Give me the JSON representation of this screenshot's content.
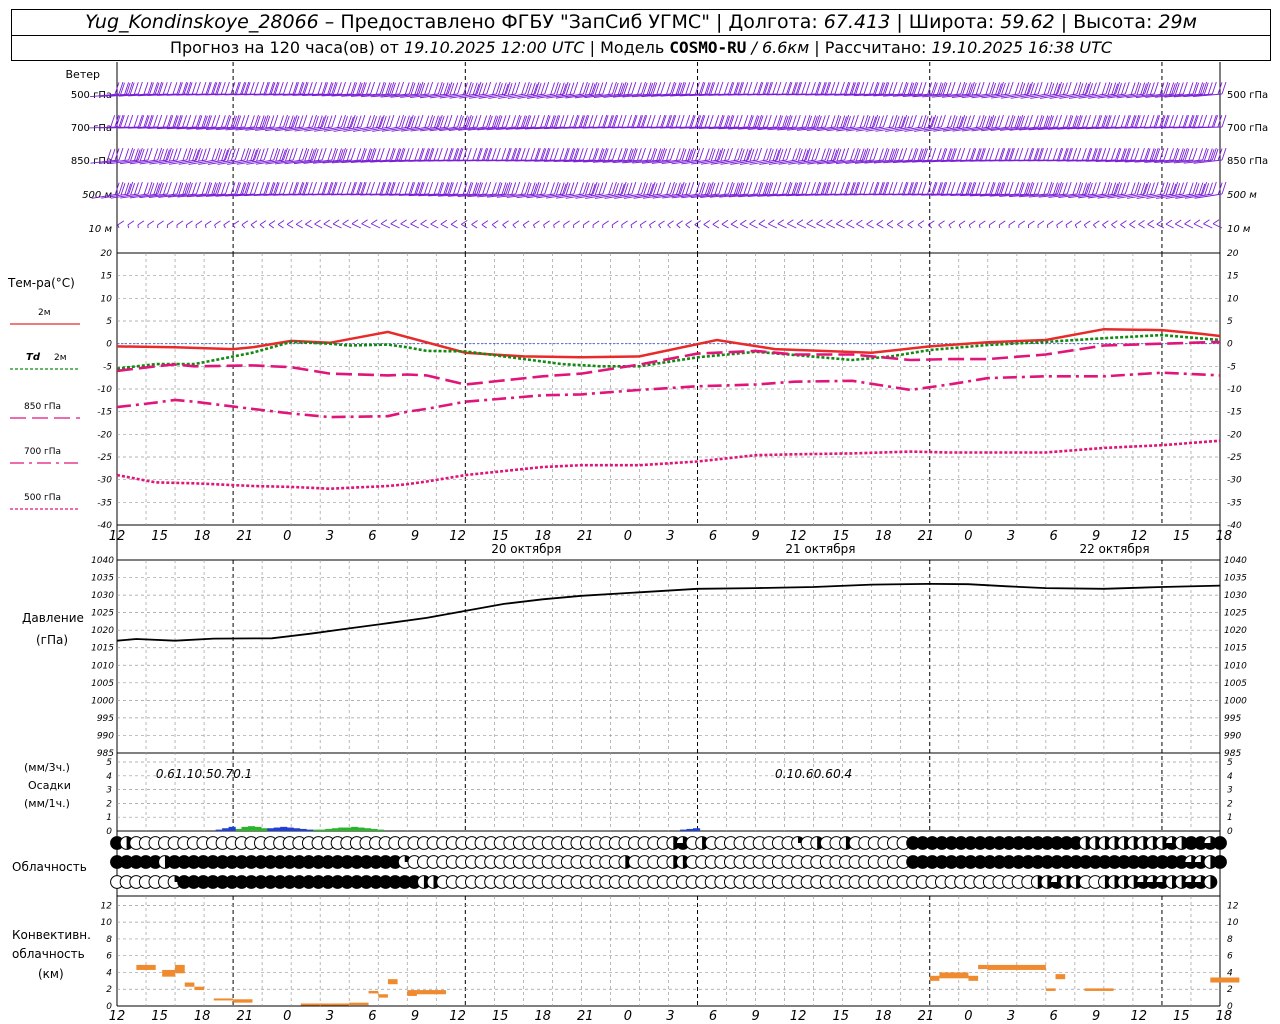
{
  "header": {
    "station": "Yug_Kondinskoye_28066",
    "provider_text": " – Предоставлено ФГБУ \"ЗапСиб УГМС\" | Долгота: ",
    "lon": "67.413",
    "lat_label": " | Широта: ",
    "lat": "59.62",
    "alt_label": " | Высота: ",
    "alt": "29м",
    "forecast_label": "Прогноз на 120 часа(ов) от ",
    "start_time": "19.10.2025 12:00 UTC",
    "model_label": " | Модель ",
    "model": "COSMO-RU",
    "resolution": " / 6.6км",
    "computed_label": " | Рассчитано: ",
    "computed": "19.10.2025 16:38 UTC"
  },
  "chart_data": [
    {
      "type": "wind-barbs",
      "label": "Ветер",
      "levels": [
        "500 гПа",
        "700 гПа",
        "850 гПа",
        "500 м",
        "10 м"
      ],
      "color": "#7a1fd6"
    },
    {
      "type": "line",
      "ylabel": "Тем-ра(°C)",
      "ylim": [
        -40,
        20
      ],
      "yticks": [
        20,
        15,
        10,
        5,
        0,
        -5,
        -10,
        -15,
        -20,
        -25,
        -30,
        -35,
        -40
      ],
      "series": [
        {
          "name": "2м",
          "color": "#e82a2a",
          "style": "solid",
          "x": [
            0,
            9,
            18,
            21,
            27,
            33,
            42,
            54,
            63,
            72,
            81,
            93,
            102,
            117,
            126,
            135,
            144,
            153,
            162,
            168,
            171
          ],
          "values": [
            -0.6,
            -0.8,
            -1.2,
            -0.8,
            0.6,
            0.2,
            2.6,
            -2.0,
            -2.8,
            -3.0,
            -2.8,
            0.8,
            -1.2,
            -2.0,
            -0.6,
            0.3,
            0.8,
            3.2,
            3.0,
            2.2,
            1.7
          ]
        },
        {
          "name": "Td 2м",
          "color": "#128a12",
          "style": "dotted",
          "x": [
            0,
            6,
            12,
            21,
            27,
            33,
            36,
            42,
            45,
            48,
            54,
            60,
            69,
            75,
            81,
            90,
            99,
            105,
            114,
            120,
            126,
            135,
            144,
            153,
            162,
            171
          ],
          "values": [
            -5.5,
            -4.5,
            -4.5,
            -2.0,
            0.4,
            0.0,
            -0.4,
            -0.2,
            -0.8,
            -1.6,
            -1.7,
            -2.8,
            -4.5,
            -5.0,
            -5.0,
            -3.0,
            -1.8,
            -2.5,
            -3.6,
            -2.8,
            -1.4,
            -0.3,
            0.4,
            1.2,
            1.9,
            0.8
          ]
        },
        {
          "name": "850 гПа",
          "color": "#e0147a",
          "style": "long-dash",
          "x": [
            0,
            6,
            9,
            12,
            21,
            27,
            33,
            42,
            45,
            48,
            54,
            66,
            72,
            81,
            90,
            99,
            105,
            114,
            123,
            129,
            135,
            144,
            153,
            162,
            171
          ],
          "values": [
            -6.0,
            -5.0,
            -4.6,
            -5.0,
            -4.8,
            -5.2,
            -6.6,
            -7.0,
            -6.8,
            -7.0,
            -9.0,
            -7.2,
            -6.6,
            -4.6,
            -2.2,
            -1.6,
            -2.4,
            -2.4,
            -3.6,
            -3.4,
            -3.4,
            -2.4,
            -0.4,
            0.0,
            0.4
          ]
        },
        {
          "name": "700 гПа",
          "color": "#e0147a",
          "style": "dash-dot",
          "x": [
            0,
            6,
            9,
            12,
            21,
            27,
            33,
            42,
            45,
            48,
            54,
            66,
            72,
            81,
            90,
            99,
            105,
            114,
            123,
            129,
            135,
            144,
            153,
            162,
            171
          ],
          "values": [
            -14.0,
            -13.0,
            -12.4,
            -12.8,
            -14.4,
            -15.4,
            -16.2,
            -16.0,
            -15.0,
            -14.4,
            -12.8,
            -11.4,
            -11.2,
            -10.2,
            -9.4,
            -9.0,
            -8.4,
            -8.2,
            -10.2,
            -9.0,
            -7.6,
            -7.2,
            -7.2,
            -6.4,
            -7.0
          ]
        },
        {
          "name": "500 гПа",
          "color": "#e0147a",
          "style": "dotted",
          "x": [
            0,
            6,
            12,
            21,
            27,
            33,
            42,
            45,
            48,
            54,
            66,
            72,
            81,
            90,
            99,
            105,
            114,
            123,
            129,
            135,
            144,
            153,
            162,
            171
          ],
          "values": [
            -29.0,
            -30.6,
            -30.8,
            -31.4,
            -31.6,
            -32.0,
            -31.4,
            -31.0,
            -30.4,
            -29.0,
            -27.2,
            -26.8,
            -26.8,
            -26.0,
            -24.6,
            -24.4,
            -24.2,
            -23.8,
            -24.0,
            -24.0,
            -24.0,
            -23.0,
            -22.4,
            -21.4
          ]
        }
      ]
    },
    {
      "type": "line",
      "ylabel": "Давление",
      "yunit": "(гПа)",
      "ylim": [
        985,
        1040
      ],
      "yticks": [
        1040,
        1035,
        1030,
        1025,
        1020,
        1015,
        1010,
        1005,
        1000,
        995,
        990,
        985
      ],
      "series": [
        {
          "name": "Давление",
          "color": "#000000",
          "x": [
            0,
            3,
            9,
            15,
            24,
            30,
            36,
            42,
            48,
            54,
            60,
            66,
            72,
            81,
            90,
            99,
            108,
            117,
            126,
            132,
            138,
            144,
            153,
            162,
            171
          ],
          "values": [
            1017,
            1017.5,
            1017,
            1017.6,
            1017.7,
            1019,
            1020.5,
            1022,
            1023.5,
            1025.5,
            1027.5,
            1028.8,
            1029.8,
            1030.8,
            1031.8,
            1032,
            1032.3,
            1033,
            1033.2,
            1033.1,
            1032.5,
            1032,
            1031.8,
            1032.3,
            1032.7
          ]
        }
      ]
    },
    {
      "type": "bar",
      "ylabel": "(мм/3ч.)",
      "ylabel2": "Осадки",
      "ylabel3": "(мм/1ч.)",
      "ylim": [
        0,
        5
      ],
      "yticks": [
        5,
        4,
        3,
        2,
        1,
        0
      ],
      "totals": [
        {
          "x": 7.5,
          "value": "0.6"
        },
        {
          "x": 10.5,
          "value": "1.1"
        },
        {
          "x": 13.5,
          "value": "0.5"
        },
        {
          "x": 16.5,
          "value": "0.7"
        },
        {
          "x": 19.5,
          "value": "0.1"
        },
        {
          "x": 103.5,
          "value": "0.1"
        },
        {
          "x": 106.5,
          "value": "0.6"
        },
        {
          "x": 109.5,
          "value": "0.6"
        },
        {
          "x": 112.5,
          "value": "0.4"
        }
      ],
      "series": [
        {
          "name": "rain",
          "color": "#2ab42a",
          "bars": [
            [
              9,
              0.15
            ],
            [
              10,
              0.3
            ],
            [
              11,
              0.35
            ],
            [
              12,
              0.3
            ],
            [
              13,
              0.2
            ],
            [
              21,
              0.1
            ],
            [
              22,
              0.1
            ],
            [
              23,
              0.15
            ],
            [
              24,
              0.2
            ],
            [
              25,
              0.25
            ],
            [
              26,
              0.25
            ],
            [
              27,
              0.3
            ],
            [
              28,
              0.25
            ],
            [
              29,
              0.2
            ],
            [
              30,
              0.15
            ],
            [
              31,
              0.1
            ]
          ]
        },
        {
          "name": "snow",
          "color": "#1f3fd6",
          "bars": [
            [
              6,
              0.1
            ],
            [
              7,
              0.2
            ],
            [
              8,
              0.3
            ],
            [
              14,
              0.2
            ],
            [
              15,
              0.25
            ],
            [
              16,
              0.3
            ],
            [
              17,
              0.25
            ],
            [
              18,
              0.2
            ],
            [
              19,
              0.15
            ],
            [
              20,
              0.1
            ],
            [
              78,
              0.1
            ],
            [
              79,
              0.15
            ],
            [
              80,
              0.2
            ]
          ]
        }
      ]
    },
    {
      "type": "cloud-cover",
      "ylabel": "Облачность",
      "rows": [
        [
          8,
          4,
          0,
          0,
          0,
          0,
          0,
          0,
          0,
          0,
          0,
          0,
          0,
          0,
          0,
          0,
          0,
          0,
          0,
          0,
          0,
          0,
          0,
          0,
          0,
          0,
          0,
          0,
          0,
          0,
          0,
          0,
          0,
          0,
          0,
          0,
          0,
          0,
          0,
          0,
          0,
          0,
          0,
          0,
          0,
          0,
          0,
          0,
          0,
          0,
          0,
          0,
          0,
          0,
          0,
          0,
          0,
          0,
          4,
          6,
          0,
          4,
          0,
          0,
          0,
          0,
          0,
          0,
          0,
          0,
          0,
          2,
          0,
          4,
          0,
          0,
          4,
          0,
          0,
          0,
          0,
          0,
          0,
          8,
          8,
          8,
          8,
          8,
          8,
          8,
          8,
          8,
          8,
          8,
          8,
          8,
          8,
          8,
          8,
          8,
          8,
          4,
          4,
          4,
          4,
          4,
          4,
          4,
          4,
          4,
          6,
          4,
          8,
          8,
          6,
          8
        ],
        [
          8,
          8,
          8,
          8,
          8,
          4,
          8,
          8,
          8,
          8,
          8,
          8,
          8,
          8,
          8,
          8,
          8,
          8,
          8,
          8,
          8,
          8,
          8,
          8,
          8,
          8,
          8,
          8,
          8,
          8,
          2,
          0,
          0,
          0,
          0,
          0,
          0,
          0,
          0,
          0,
          0,
          0,
          0,
          0,
          0,
          0,
          0,
          0,
          0,
          0,
          0,
          0,
          0,
          4,
          0,
          0,
          0,
          0,
          4,
          4,
          0,
          0,
          0,
          0,
          0,
          0,
          0,
          0,
          0,
          0,
          0,
          0,
          0,
          0,
          0,
          0,
          0,
          0,
          0,
          0,
          0,
          0,
          0,
          8,
          8,
          8,
          8,
          8,
          8,
          8,
          8,
          8,
          8,
          8,
          8,
          8,
          8,
          8,
          8,
          8,
          8,
          8,
          8,
          8,
          8,
          8,
          8,
          8,
          8,
          8,
          8,
          8,
          6,
          6,
          4,
          8
        ],
        [
          0,
          0,
          0,
          0,
          0,
          0,
          2,
          8,
          8,
          8,
          8,
          8,
          8,
          8,
          8,
          8,
          8,
          8,
          8,
          8,
          8,
          8,
          8,
          8,
          8,
          8,
          8,
          8,
          8,
          8,
          8,
          8,
          4,
          4,
          0,
          0,
          0,
          0,
          0,
          0,
          0,
          0,
          0,
          0,
          0,
          0,
          0,
          0,
          0,
          0,
          0,
          0,
          0,
          0,
          0,
          0,
          0,
          0,
          0,
          0,
          0,
          0,
          0,
          0,
          0,
          0,
          0,
          0,
          0,
          0,
          0,
          0,
          0,
          0,
          0,
          0,
          0,
          0,
          0,
          0,
          0,
          0,
          0,
          0,
          0,
          0,
          0,
          0,
          0,
          0,
          0,
          0,
          0,
          0,
          0,
          0,
          4,
          4,
          6,
          4,
          4,
          0,
          0,
          4,
          4,
          4,
          4,
          6,
          6,
          6,
          4,
          4,
          6,
          6,
          4
        ]
      ]
    },
    {
      "type": "bar",
      "ylabel": "Конвективн.",
      "ylabel2": "облачность",
      "ylabel3": "(км)",
      "ylim": [
        0,
        13
      ],
      "yticks": [
        12,
        10,
        8,
        6,
        4,
        2,
        0
      ],
      "color": "#ef8a2e",
      "segments": [
        [
          6,
          12,
          4.3,
          4.9
        ],
        [
          14,
          18,
          3.5,
          4.3
        ],
        [
          18,
          21,
          3.9,
          4.9
        ],
        [
          21,
          24,
          2.3,
          2.8
        ],
        [
          24,
          27,
          1.9,
          2.3
        ],
        [
          30,
          36,
          0.7,
          0.9
        ],
        [
          36,
          42,
          0.4,
          0.8
        ],
        [
          57,
          66,
          0.1,
          0.3
        ],
        [
          66,
          72,
          0.1,
          0.3
        ],
        [
          72,
          78,
          0.1,
          0.4
        ],
        [
          78,
          81,
          1.5,
          1.8
        ],
        [
          81,
          84,
          1.0,
          1.4
        ],
        [
          84,
          87,
          2.6,
          3.2
        ],
        [
          90,
          93,
          1.2,
          1.9
        ],
        [
          93,
          102,
          1.4,
          1.9
        ],
        [
          252,
          255,
          3.0,
          3.6
        ],
        [
          255,
          264,
          3.3,
          4.0
        ],
        [
          264,
          267,
          3.0,
          3.6
        ],
        [
          267,
          270,
          4.4,
          4.9
        ],
        [
          270,
          288,
          4.3,
          4.9
        ],
        [
          288,
          291,
          1.8,
          2.1
        ],
        [
          291,
          294,
          3.2,
          3.8
        ],
        [
          300,
          309,
          1.8,
          2.1
        ],
        [
          339,
          348,
          2.8,
          3.4
        ]
      ]
    }
  ],
  "axis": {
    "hour_labels": [
      "12",
      "15",
      "18",
      "21",
      "0",
      "3",
      "6",
      "9",
      "12",
      "15",
      "18",
      "21",
      "0",
      "3",
      "6",
      "9",
      "12",
      "15",
      "18",
      "21",
      "0",
      "3",
      "6",
      "9",
      "12",
      "15",
      "18"
    ],
    "dates": [
      {
        "x": 33,
        "text": "20 октября"
      },
      {
        "x": 57,
        "text": "21 октября"
      },
      {
        "x": 81,
        "text": "22 октября"
      }
    ]
  },
  "legend": {
    "t2m": "2м",
    "td": "Td",
    "td_sub": "2м",
    "p850": "850 гПа",
    "p700": "700 гПа",
    "p500": "500 гПа"
  }
}
